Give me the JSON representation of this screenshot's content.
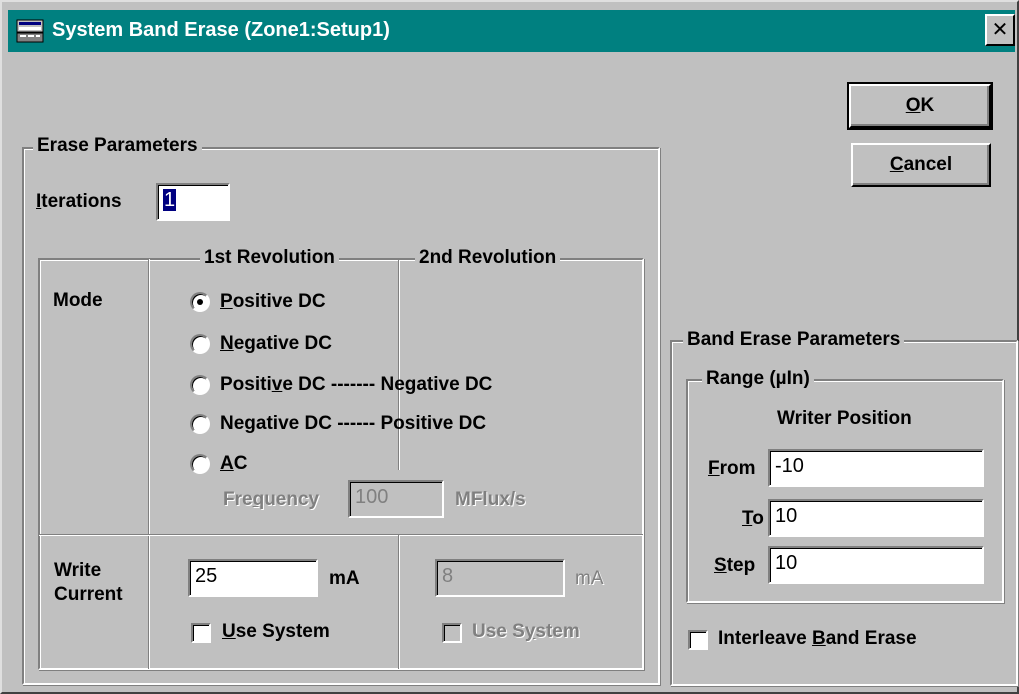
{
  "window": {
    "title": "System Band Erase (Zone1:Setup1)",
    "close_glyph": "✕"
  },
  "buttons": {
    "ok": {
      "pre": "",
      "mnemonic": "O",
      "post": "K"
    },
    "cancel": {
      "pre": "",
      "mnemonic": "C",
      "post": "ancel"
    }
  },
  "erase_parameters": {
    "label": "Erase Parameters",
    "iterations": {
      "pre": "",
      "mnemonic": "I",
      "post": "terations",
      "value": "1"
    },
    "revolution_headers": {
      "first": "1st Revolution",
      "second": "2nd Revolution"
    },
    "mode_label": "Mode",
    "modes": [
      {
        "pre": "",
        "mnemonic": "P",
        "post": "ositive DC",
        "selected": true
      },
      {
        "pre": "",
        "mnemonic": "N",
        "post": "egative DC",
        "selected": false
      },
      {
        "pre": "Positi",
        "mnemonic": "v",
        "post": "e DC",
        "second": "Negative DC",
        "dashes": "-------",
        "selected": false
      },
      {
        "pre": "Ne",
        "mnemonic": "g",
        "post": "ative DC",
        "second": "Positive DC",
        "dashes": "------",
        "selected": false
      },
      {
        "pre": "",
        "mnemonic": "A",
        "post": "C",
        "selected": false
      }
    ],
    "frequency": {
      "pre": "Fre",
      "mnemonic": "q",
      "post": "uency",
      "value": "100",
      "unit": "MFlux/s"
    },
    "write_current": {
      "label_line1": "Write",
      "label_line2": "Current",
      "first_value": "25",
      "second_value": "8",
      "unit": "mA",
      "use_system_1": {
        "pre": "",
        "mnemonic": "U",
        "post": "se System",
        "checked": false
      },
      "use_system_2": {
        "pre": "Use S",
        "mnemonic": "y",
        "post": "stem",
        "checked": false
      }
    }
  },
  "band_erase_parameters": {
    "label": "Band Erase Parameters",
    "range_label": "Range (µIn)",
    "writer_position_label": "Writer Position",
    "from": {
      "pre": "",
      "mnemonic": "F",
      "post": "rom",
      "value": "-10"
    },
    "to": {
      "pre": "",
      "mnemonic": "T",
      "post": "o",
      "value": "10"
    },
    "step": {
      "pre": "",
      "mnemonic": "S",
      "post": "tep",
      "value": "10"
    },
    "interleave": {
      "pre": "Interleave ",
      "mnemonic": "B",
      "post": "and Erase",
      "checked": false
    }
  }
}
